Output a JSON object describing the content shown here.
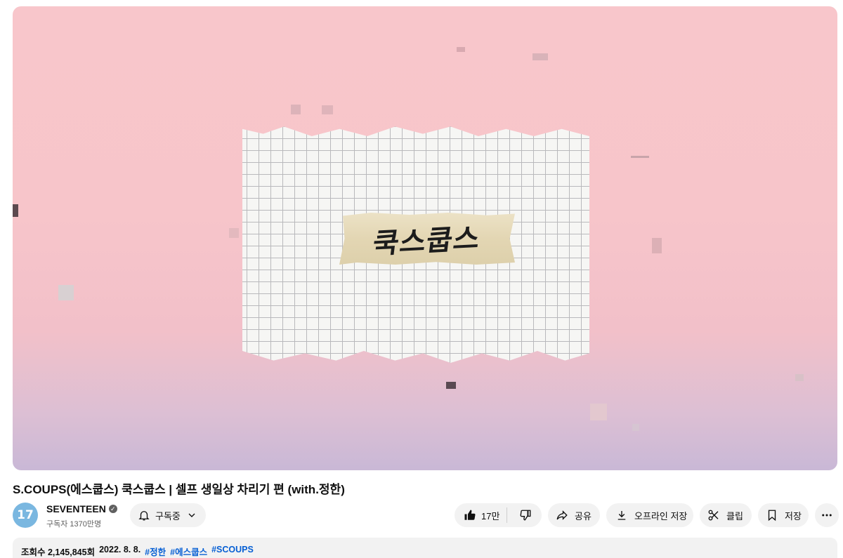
{
  "video": {
    "thumbnail_text": "쿡스쿱스",
    "title": "S.COUPS(에스쿱스) 쿡스쿱스 | 셀프 생일상 차리기 편 (with.정한)",
    "colors": {
      "background_top": "#f8c6cb",
      "background_bottom": "#c9b8d6",
      "tape": "#e3d6b3"
    }
  },
  "channel": {
    "avatar_text": "17",
    "name": "SEVENTEEN",
    "verified_icon": "verified-check-icon",
    "subscribers": "구독자 1370만명",
    "subscribe_label": "구독중"
  },
  "actions": {
    "like_count": "17만",
    "share_label": "공유",
    "offline_label": "오프라인 저장",
    "clip_label": "클립",
    "save_label": "저장",
    "more_icon": "more-horizontal-icon"
  },
  "description": {
    "views": "조회수 2,145,845회",
    "date": "2022. 8. 8.",
    "tags": [
      "#정한",
      "#에스쿱스",
      "#SCOUPS"
    ]
  }
}
